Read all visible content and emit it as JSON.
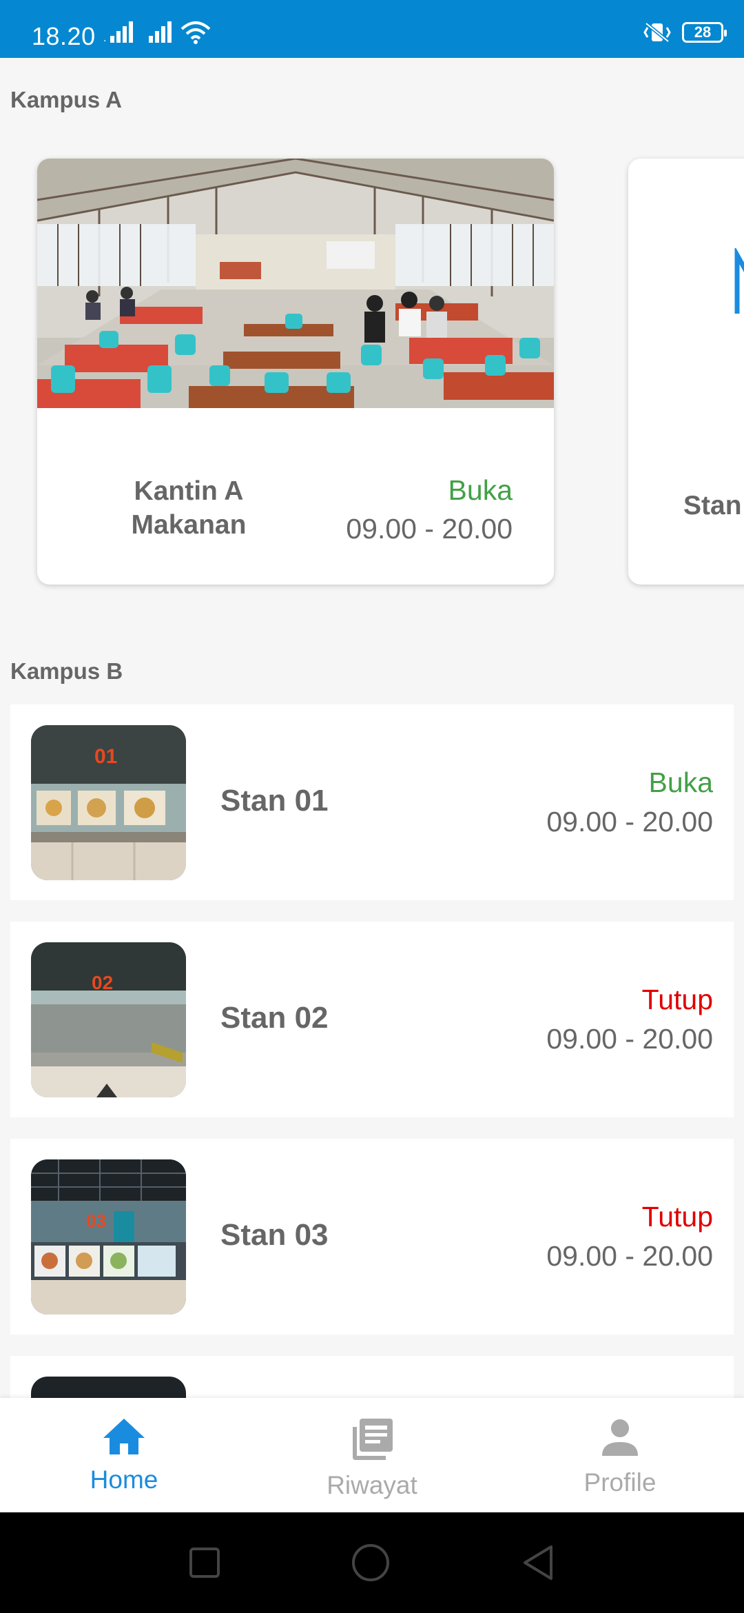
{
  "status_bar": {
    "time": "18.20",
    "battery": "28",
    "icons": [
      "signal-icon",
      "signal-icon",
      "wifi-icon",
      "vibrate-icon",
      "battery-icon"
    ],
    "bg_color": "#0588d1"
  },
  "sections": {
    "kampus_a": "Kampus A",
    "kampus_b": "Kampus B"
  },
  "kampus_a_cards": [
    {
      "name": "Kantin A Makanan",
      "status": "Buka",
      "hours": "09.00 - 20.00",
      "status_color": "#43a047"
    },
    {
      "name": "Stan"
    }
  ],
  "kampus_b_items": [
    {
      "name": "Stan 01",
      "status": "Buka",
      "hours": "09.00 - 20.00",
      "badge": "01",
      "status_color": "#43a047"
    },
    {
      "name": "Stan 02",
      "status": "Tutup",
      "hours": "09.00 - 20.00",
      "badge": "02",
      "status_color": "#e00000"
    },
    {
      "name": "Stan 03",
      "status": "Tutup",
      "hours": "09.00 - 20.00",
      "badge": "03",
      "status_color": "#e00000"
    }
  ],
  "bottom_nav": {
    "home": "Home",
    "riwayat": "Riwayat",
    "profile": "Profile",
    "active": "home",
    "active_color": "#1a8ce0"
  },
  "system_nav": [
    "recents-icon",
    "home-circle-icon",
    "back-icon"
  ]
}
